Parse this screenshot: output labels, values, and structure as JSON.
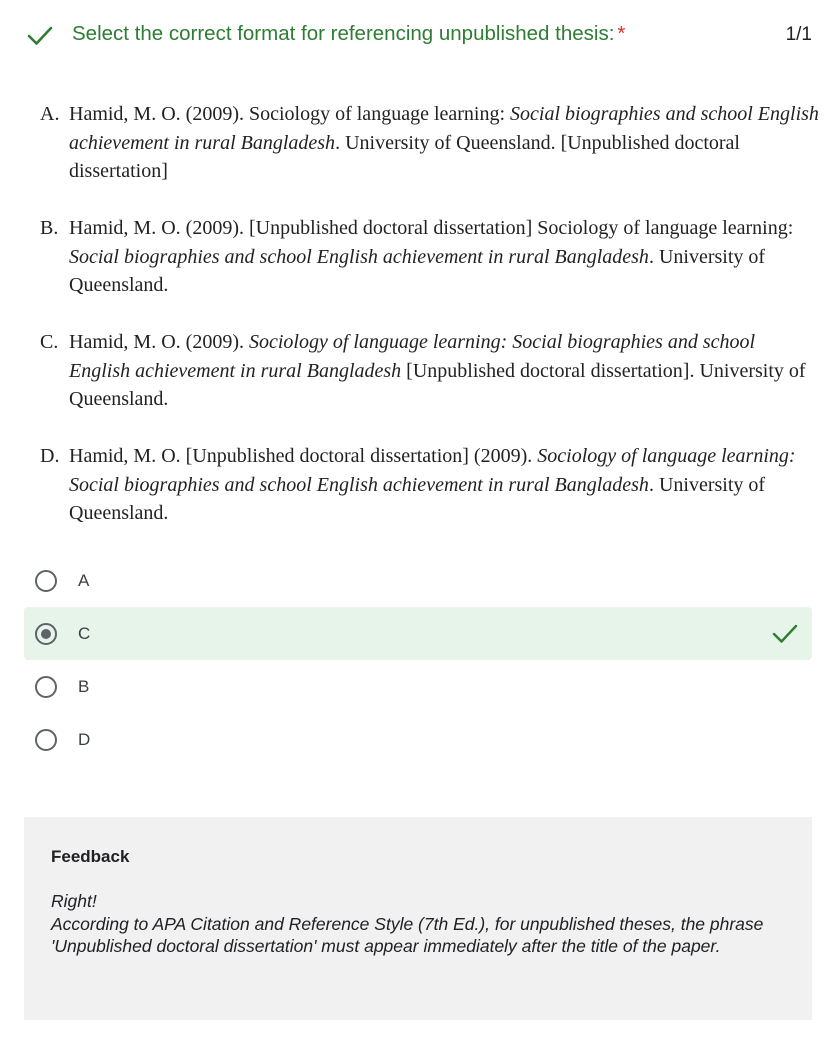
{
  "question": {
    "title": "Select the correct format for referencing unpublished thesis:",
    "required_mark": "*",
    "score": "1/1",
    "status_icon": "check-icon",
    "accent_color": "#2e7d32"
  },
  "references": [
    {
      "letter": "A.",
      "pre": "Hamid, M. O. (2009). Sociology of language learning: ",
      "italic": "Social biographies and school English achievement in rural Bangladesh",
      "post": ". University of Queensland. [Unpublished doctoral dissertation]"
    },
    {
      "letter": "B.",
      "pre": "Hamid, M. O. (2009). [Unpublished doctoral dissertation] Sociology of language learning: ",
      "italic": "Social biographies and school English achievement in rural Bangladesh",
      "post": ". University of Queensland."
    },
    {
      "letter": "C.",
      "pre": "Hamid, M. O. (2009). ",
      "italic": "Sociology of language learning: Social biographies and school English achievement in rural Bangladesh",
      "post": " [Unpublished doctoral dissertation]. University of Queensland."
    },
    {
      "letter": "D.",
      "pre": "Hamid, M. O. [Unpublished doctoral dissertation] (2009).  ",
      "italic": "Sociology of language learning: Social biographies and school English achievement in rural Bangladesh",
      "post": ". University of Queensland."
    }
  ],
  "options": [
    {
      "label": "A",
      "selected": false,
      "correct": false
    },
    {
      "label": "C",
      "selected": true,
      "correct": true
    },
    {
      "label": "B",
      "selected": false,
      "correct": false
    },
    {
      "label": "D",
      "selected": false,
      "correct": false
    }
  ],
  "feedback": {
    "title": "Feedback",
    "line1": "Right!",
    "body": "According to APA Citation and Reference Style (7th Ed.), for unpublished theses, the phrase 'Unpublished doctoral dissertation' must appear immediately after the title of the paper."
  },
  "colors": {
    "selected_bg": "#e6f4ea",
    "feedback_bg": "#f1f1f1",
    "required": "#d93025"
  }
}
